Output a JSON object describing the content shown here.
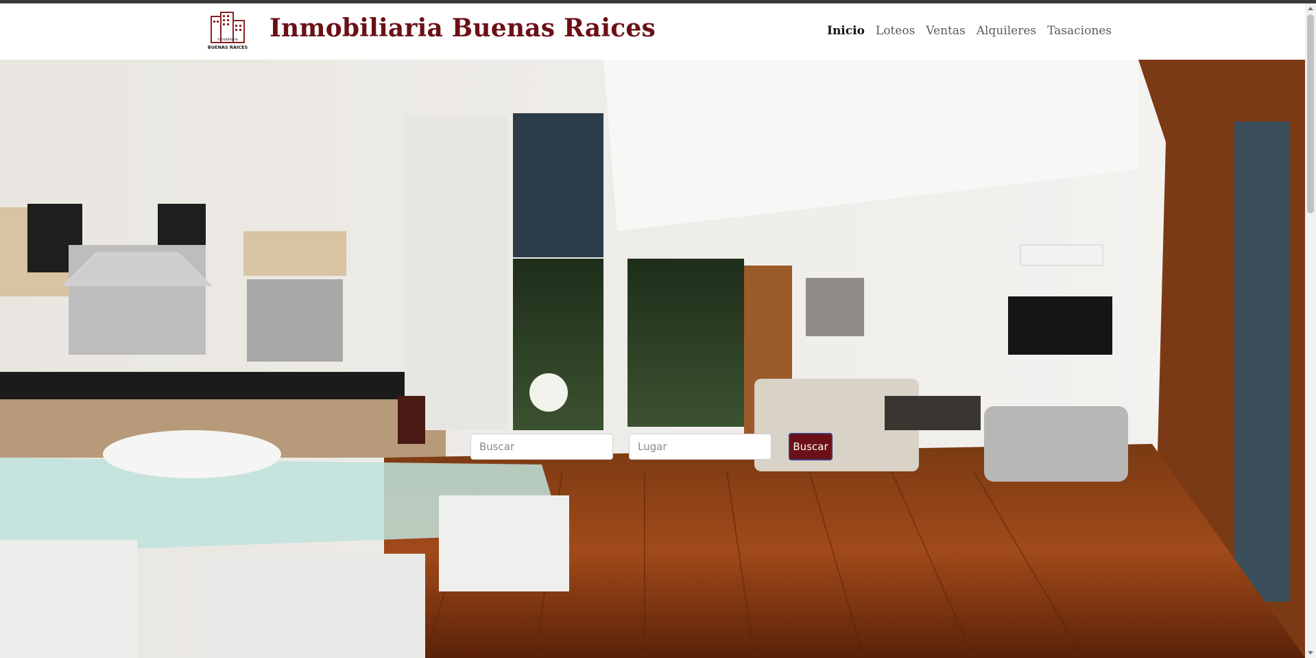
{
  "header": {
    "brand": "Inmobiliaria Buenas Raices",
    "logo_small_text": "Inmobiliaria",
    "logo_text": "BUENAS RAICES",
    "nav": [
      {
        "label": "Inicio",
        "active": true
      },
      {
        "label": "Loteos",
        "active": false
      },
      {
        "label": "Ventas",
        "active": false
      },
      {
        "label": "Alquileres",
        "active": false
      },
      {
        "label": "Tasaciones",
        "active": false
      }
    ]
  },
  "search": {
    "query_placeholder": "Buscar",
    "place_placeholder": "Lugar",
    "button_label": "Buscar"
  },
  "colors": {
    "brand": "#6b1016",
    "nav_text": "#5a5a5a",
    "nav_active": "#111111"
  },
  "hero": {
    "image_description_icon": "living-room-photo"
  }
}
